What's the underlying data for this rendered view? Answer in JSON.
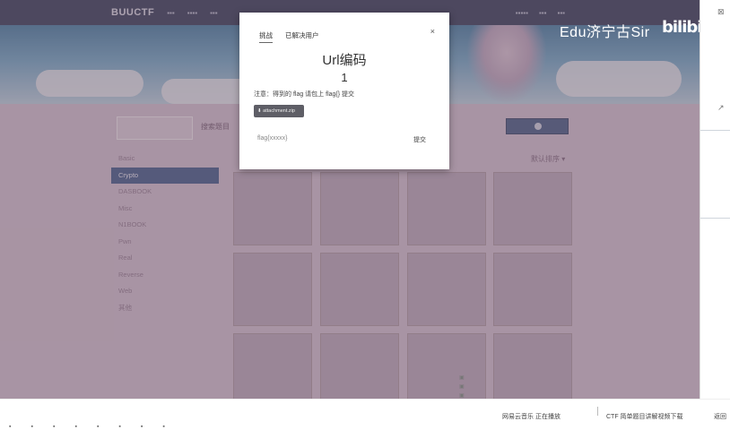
{
  "navbar": {
    "brand": "BUUCTF",
    "items": [
      "",
      "",
      ""
    ],
    "right_items": [
      "",
      "",
      ""
    ]
  },
  "search": {
    "button_label": "搜索题目"
  },
  "sidebar": {
    "items": [
      {
        "label": "Basic",
        "active": false
      },
      {
        "label": "Crypto",
        "active": true
      },
      {
        "label": "DASBOOK",
        "active": false
      },
      {
        "label": "Misc",
        "active": false
      },
      {
        "label": "N1BOOK",
        "active": false
      },
      {
        "label": "Pwn",
        "active": false
      },
      {
        "label": "Real",
        "active": false
      },
      {
        "label": "Reverse",
        "active": false
      },
      {
        "label": "Web",
        "active": false
      },
      {
        "label": "其他",
        "active": false
      }
    ]
  },
  "sort_label": "默认排序 ▾",
  "modal": {
    "tabs": [
      "挑战",
      "已解决用户"
    ],
    "title": "Url编码",
    "score": "1",
    "note": "注意：得到的 flag 请包上 flag{} 提交",
    "download_label": "attachment.zip",
    "flag_placeholder": "flag{xxxxx}",
    "submit_label": "提交",
    "close": "×"
  },
  "watermark": {
    "text": "Edu济宁古Sir",
    "logo": "bilibili"
  },
  "taskbar": {
    "ticker1": "网易云音乐 正在播放",
    "ticker2": "CTF 简单题目讲解视频下载",
    "ticker3": "返回"
  },
  "colors": {
    "navbar": "#2b3a52",
    "active_side": "#3a5a86",
    "overlay": "#cfc3cf"
  }
}
